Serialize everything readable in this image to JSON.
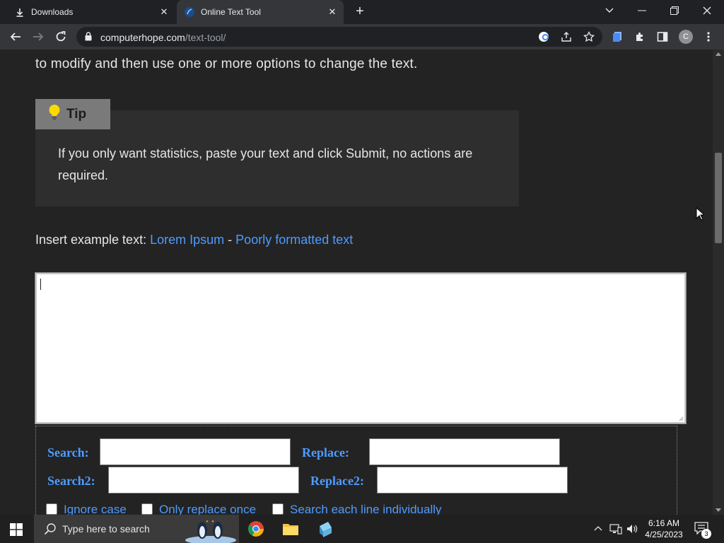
{
  "browser": {
    "tabs": [
      {
        "title": "Downloads",
        "icon": "download-icon",
        "active": false
      },
      {
        "title": "Online Text Tool",
        "icon": "computerhope-favicon",
        "active": true
      }
    ],
    "url_host": "computerhope.com",
    "url_path": "/text-tool/",
    "profile_initial": "C"
  },
  "page": {
    "intro_line": "to modify and then use one or more options to change the text.",
    "tip": {
      "label": "Tip",
      "text": "If you only want statistics, paste your text and click Submit, no actions are required."
    },
    "example": {
      "label": "Insert example text:",
      "link1": "Lorem Ipsum",
      "separator": "-",
      "link2": "Poorly formatted text"
    },
    "textarea_value": "",
    "options": {
      "search_label": "Search:",
      "replace_label": "Replace:",
      "search2_label": "Search2:",
      "replace2_label": "Replace2:",
      "checkboxes": [
        {
          "label": "Ignore case",
          "checked": false
        },
        {
          "label": "Only replace once",
          "checked": false
        },
        {
          "label": "Search each line individually",
          "checked": false
        }
      ]
    }
  },
  "taskbar": {
    "search_placeholder": "Type here to search",
    "time": "6:16 AM",
    "date": "4/25/2023",
    "notification_count": "3"
  },
  "colors": {
    "link": "#4e9bff",
    "page_bg": "#232323",
    "tip_label_bg": "#7a7a7a"
  }
}
